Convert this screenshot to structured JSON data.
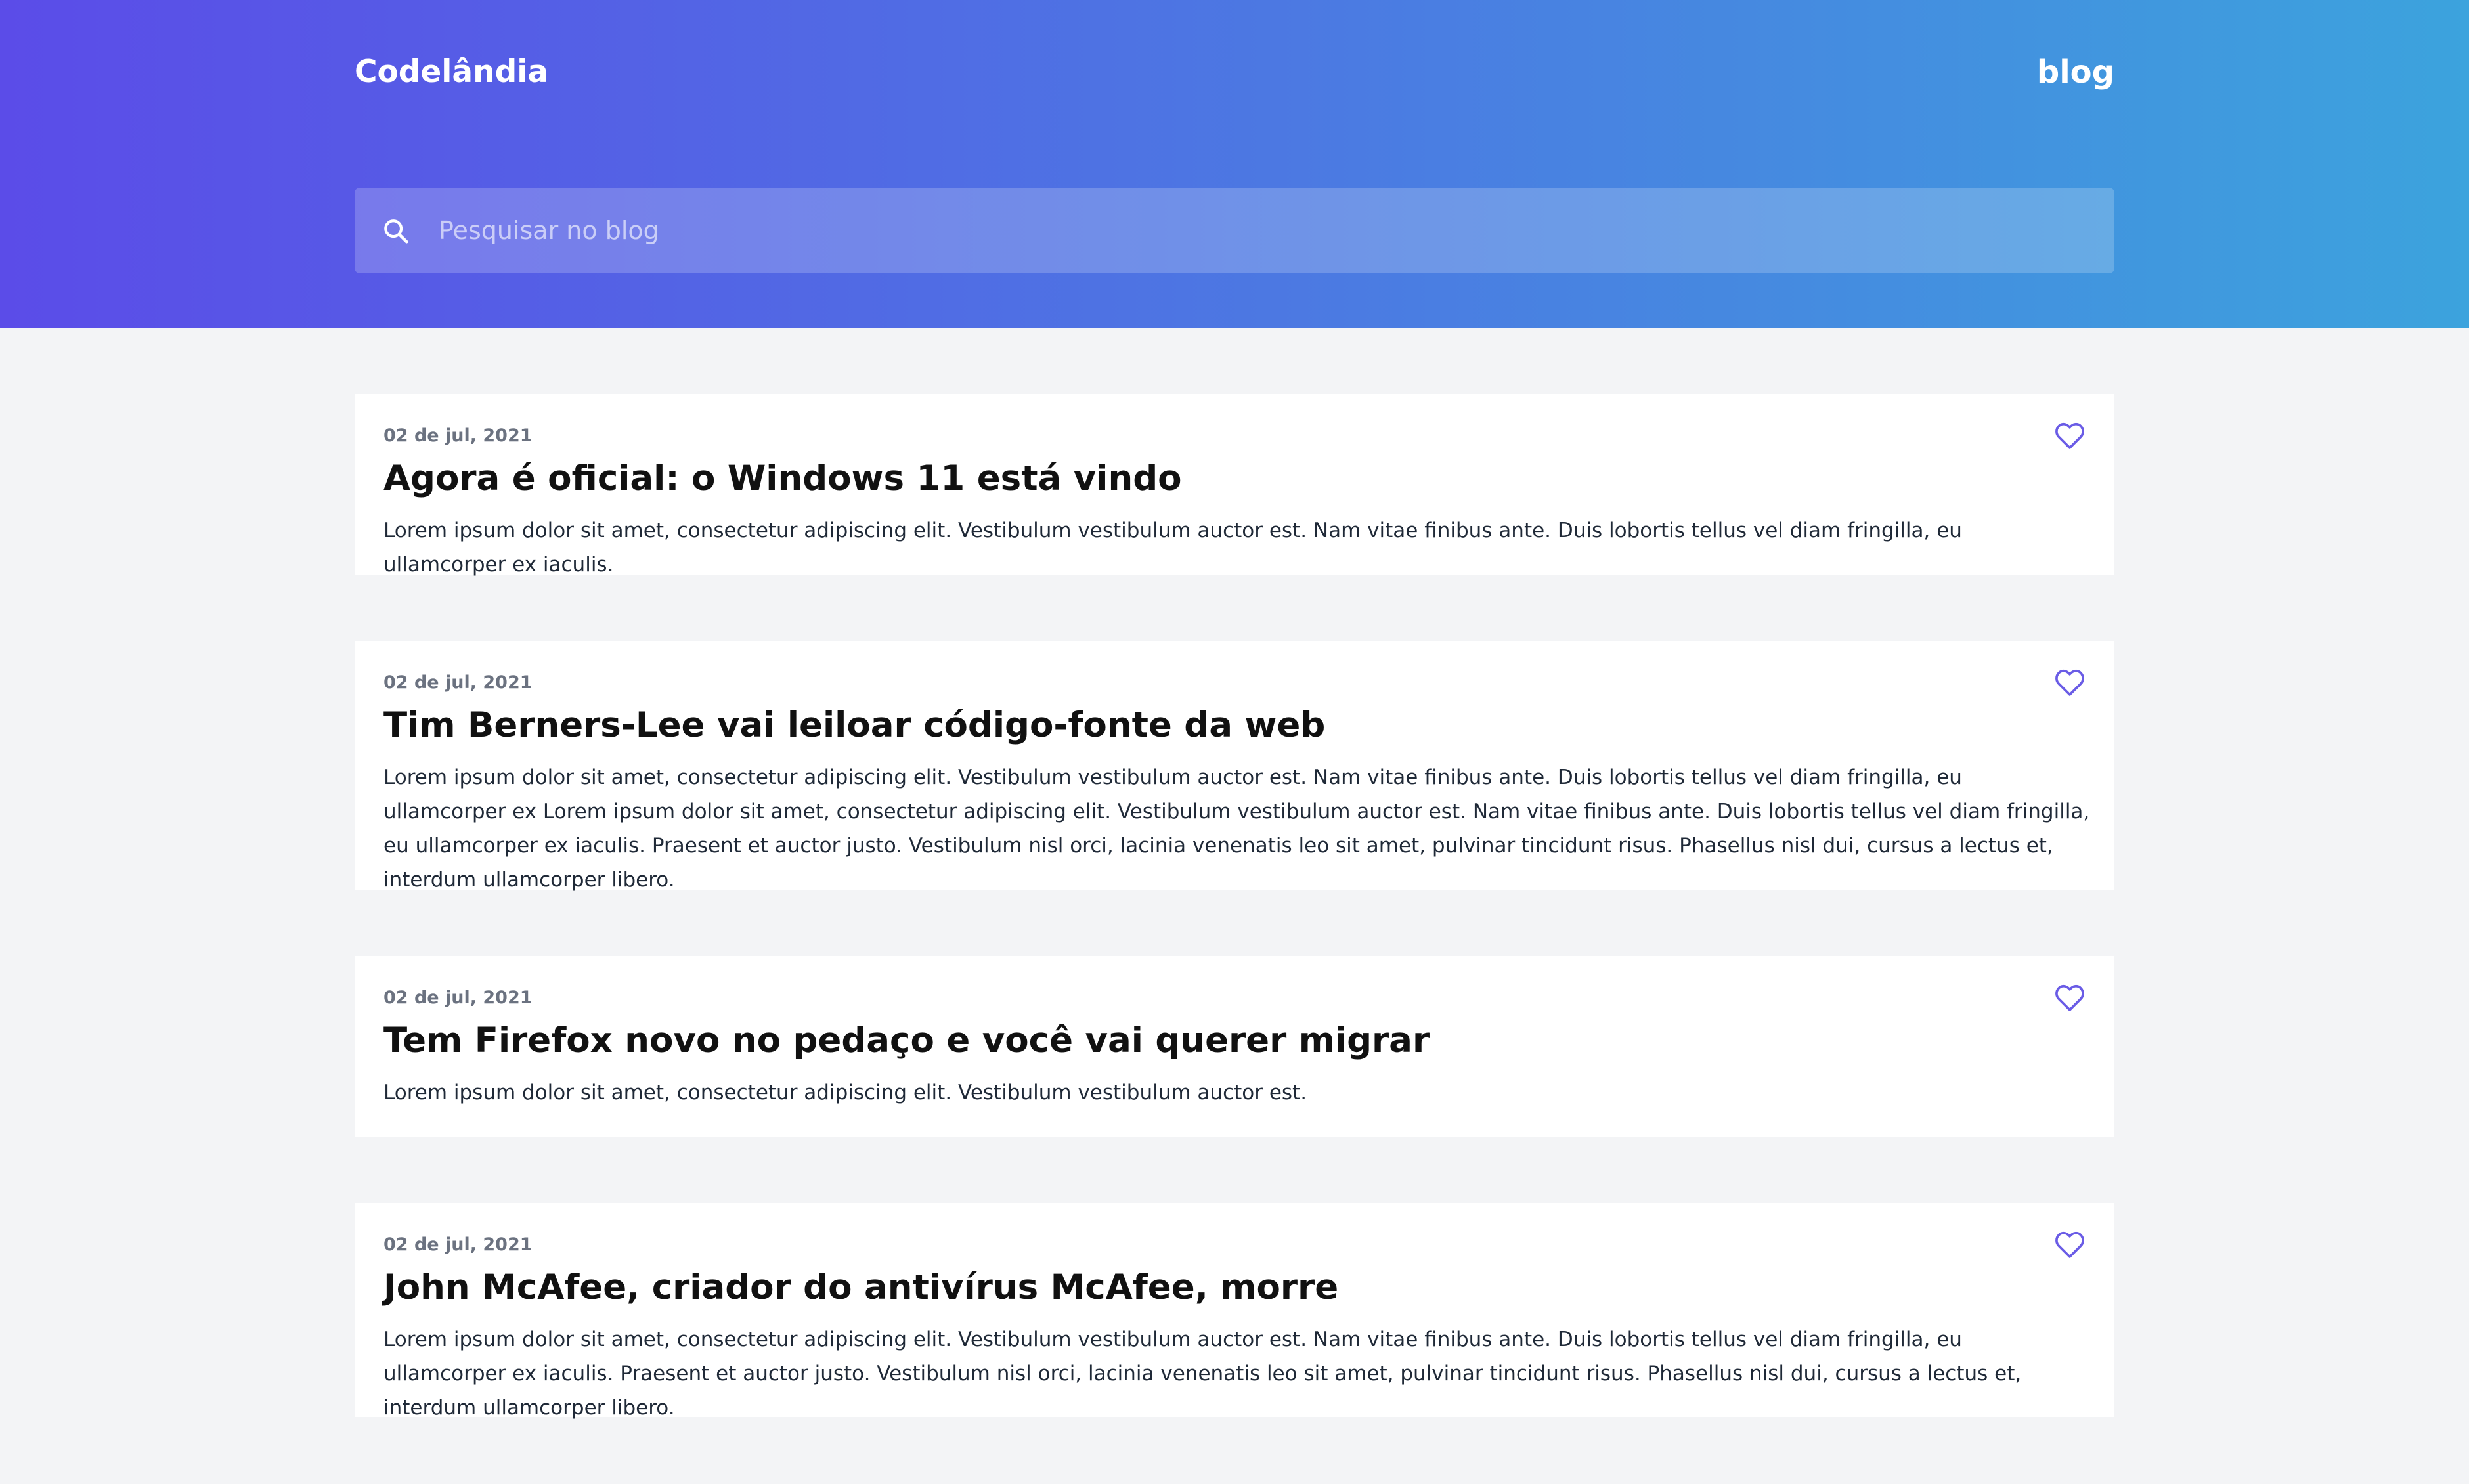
{
  "header": {
    "brand": "Codelândia",
    "nav_blog": "blog",
    "search_placeholder": "Pesquisar no blog",
    "search_value": ""
  },
  "colors": {
    "gradient_start": "#5b4ce8",
    "gradient_end": "#3ca3dd",
    "heart": "#6a5ce6",
    "background": "#f3f4f6"
  },
  "posts": [
    {
      "date": "02 de jul, 2021",
      "title": "Agora é oficial: o Windows 11 está vindo",
      "body": "Lorem ipsum dolor sit amet, consectetur adipiscing elit. Vestibulum vestibulum auctor est. Nam vitae finibus ante. Duis lobortis tellus vel diam fringilla, eu ullamcorper ex iaculis.",
      "icon": "heart-outline-icon"
    },
    {
      "date": "02 de jul, 2021",
      "title": "Tim Berners-Lee vai leiloar código-fonte da web",
      "body": "Lorem ipsum dolor sit amet, consectetur adipiscing elit. Vestibulum vestibulum auctor est. Nam vitae finibus ante. Duis lobortis tellus vel diam fringilla, eu ullamcorper ex Lorem ipsum dolor sit amet, consectetur adipiscing elit. Vestibulum vestibulum auctor est. Nam vitae finibus ante. Duis lobortis tellus vel diam fringilla, eu ullamcorper ex iaculis. Praesent et auctor justo. Vestibulum nisl orci, lacinia venenatis leo sit amet, pulvinar tincidunt risus. Phasellus nisl dui, cursus a lectus et, interdum ullamcorper libero.",
      "icon": "heart-outline-icon"
    },
    {
      "date": "02 de jul, 2021",
      "title": "Tem Firefox novo no pedaço e você vai querer migrar",
      "body": "Lorem ipsum dolor sit amet, consectetur adipiscing elit. Vestibulum vestibulum auctor est.",
      "icon": "heart-outline-icon"
    },
    {
      "date": "02 de jul, 2021",
      "title": "John McAfee, criador do antivírus McAfee, morre",
      "body": "Lorem ipsum dolor sit amet, consectetur adipiscing elit. Vestibulum vestibulum auctor est. Nam vitae finibus ante. Duis lobortis tellus vel diam fringilla, eu ullamcorper ex iaculis. Praesent et auctor justo. Vestibulum nisl orci, lacinia venenatis leo sit amet, pulvinar tincidunt risus. Phasellus nisl dui, cursus a lectus et, interdum ullamcorper libero.",
      "icon": "heart-outline-icon"
    }
  ]
}
